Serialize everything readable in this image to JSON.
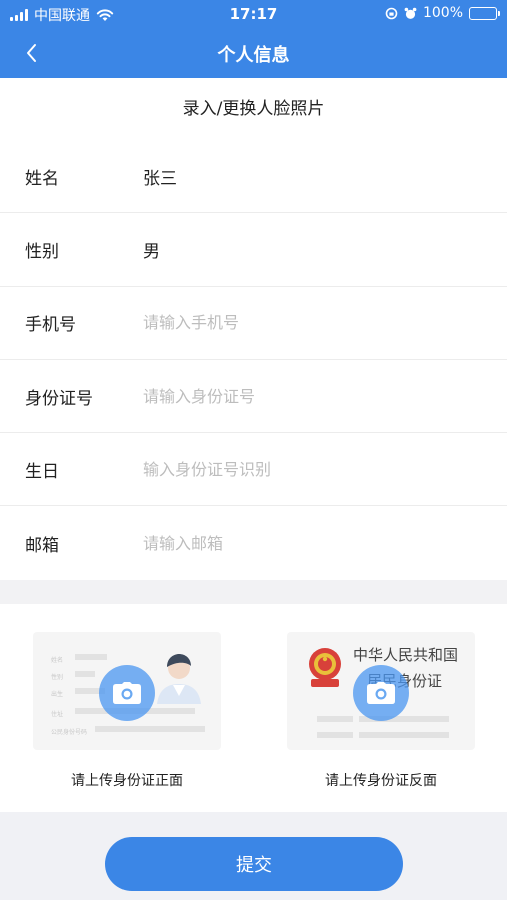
{
  "status_bar": {
    "carrier": "中国联通",
    "time": "17:17",
    "battery": "100%"
  },
  "nav": {
    "title": "个人信息",
    "back_icon": "chevron-left-icon"
  },
  "face_photo": {
    "label": "录入/更换人脸照片"
  },
  "form": {
    "name": {
      "label": "姓名",
      "value": "张三"
    },
    "gender": {
      "label": "性别",
      "value": "男"
    },
    "phone": {
      "label": "手机号",
      "placeholder": "请输入手机号"
    },
    "id_number": {
      "label": "身份证号",
      "placeholder": "请输入身份证号"
    },
    "birthday": {
      "label": "生日",
      "placeholder": "输入身份证号识别"
    },
    "email": {
      "label": "邮箱",
      "placeholder": "请输入邮箱"
    }
  },
  "id_upload": {
    "front": {
      "caption": "请上传身份证正面",
      "fields": [
        "姓名",
        "性别",
        "出生",
        "住址",
        "公民身份号码"
      ]
    },
    "back": {
      "caption": "请上传身份证反面",
      "title": "中华人民共和国",
      "subtitle": "居民身份证"
    }
  },
  "submit": {
    "label": "提交"
  },
  "colors": {
    "accent": "#3b86e6",
    "camera_overlay": "#4a96f0",
    "placeholder": "#bdbdbd",
    "battery_fill": "#7ddc6b"
  }
}
